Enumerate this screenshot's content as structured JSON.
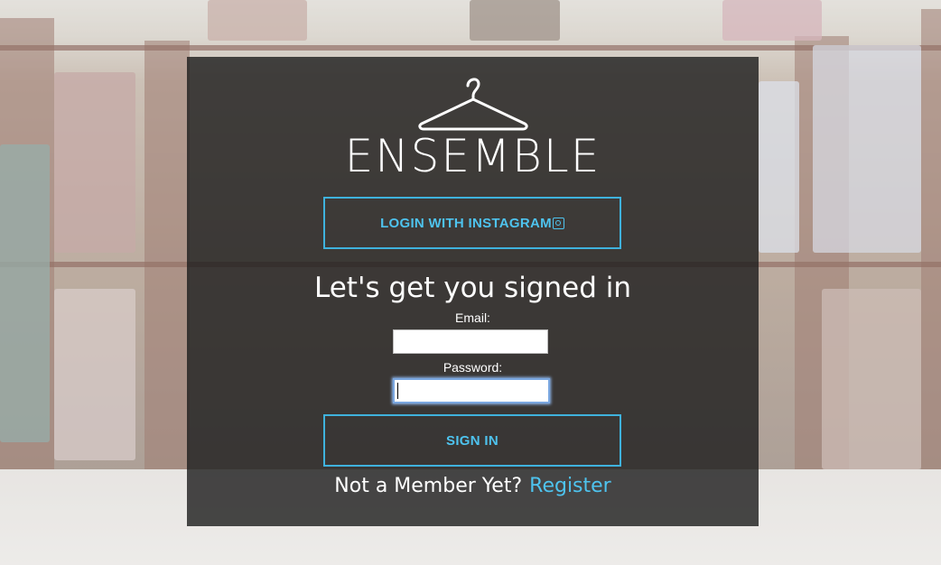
{
  "app": {
    "logo_text": "ENSEMBLE",
    "logo_icon": "hanger-icon"
  },
  "login": {
    "instagram_button_label": "LOGIN WITH INSTAGRAM",
    "instagram_icon": "instagram-icon",
    "heading": "Let's get you signed in",
    "email_label": "Email:",
    "email_value": "",
    "password_label": "Password:",
    "password_value": "",
    "signin_button_label": "SIGN IN"
  },
  "footer": {
    "prompt": "Not a Member Yet?",
    "register_link": "Register"
  },
  "colors": {
    "accent": "#4ec3ee",
    "card_background": "rgba(28,28,28,0.80)",
    "text": "#ffffff"
  }
}
